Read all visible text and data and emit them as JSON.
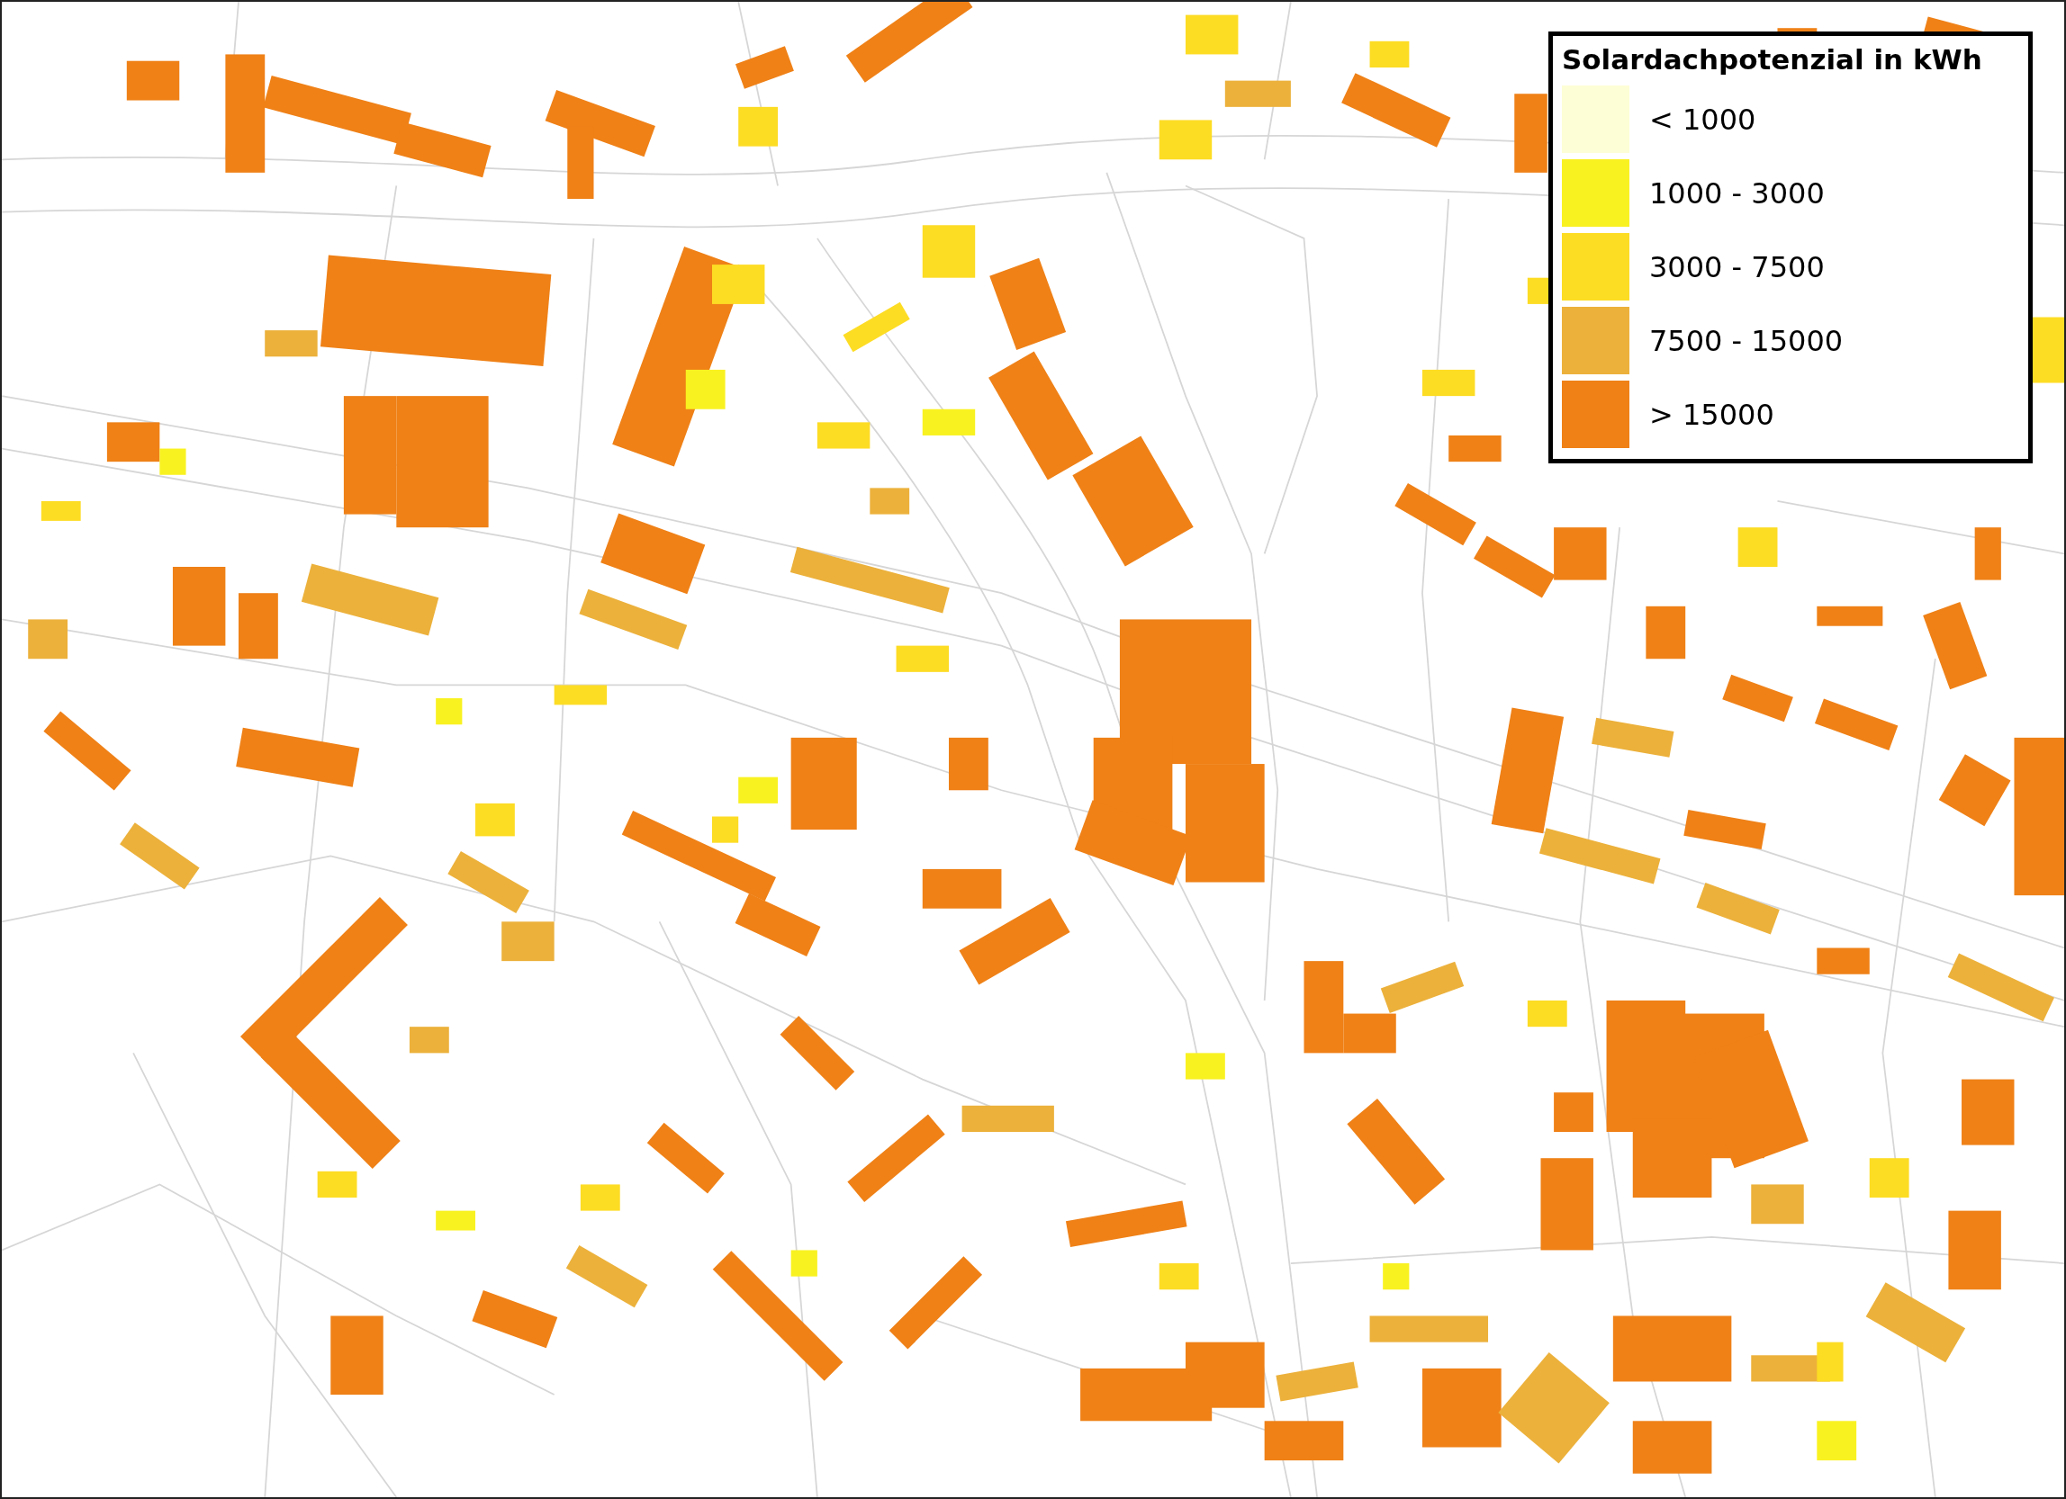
{
  "legend": {
    "title": "Solardachpotenzial in kWh",
    "items": [
      {
        "label": "< 1000",
        "color": "#fefed6"
      },
      {
        "label": "1000 - 3000",
        "color": "#f9f221"
      },
      {
        "label": "3000 - 7500",
        "color": "#fddc24"
      },
      {
        "label": "7500 - 15000",
        "color": "#ecb13b"
      },
      {
        "label": "> 15000",
        "color": "#ef8117"
      }
    ]
  }
}
